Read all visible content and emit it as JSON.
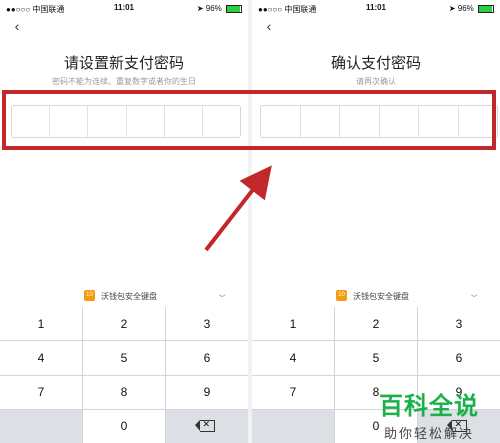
{
  "status_bar": {
    "carrier": "●●○○○ 中国联通",
    "time": "11:01",
    "battery_text": "96%",
    "battery_level": 0.96
  },
  "left": {
    "title": "请设置新支付密码",
    "subtitle": "密码不能为连续、重复数字或者你的生日",
    "pin_cells": 6
  },
  "right": {
    "title": "确认支付密码",
    "subtitle": "请再次确认",
    "pin_cells": 6
  },
  "keyboard": {
    "logo_text": "10",
    "label": "沃钱包安全键盘",
    "keys": [
      "1",
      "2",
      "3",
      "4",
      "5",
      "6",
      "7",
      "8",
      "9",
      "",
      "0",
      "⌫"
    ]
  },
  "watermark": {
    "line1": "百科全说",
    "line2": "助你轻松解决"
  },
  "colors": {
    "highlight": "#c0282b",
    "keyboard_logo": "#f39c12",
    "watermark": "#18b14a"
  }
}
